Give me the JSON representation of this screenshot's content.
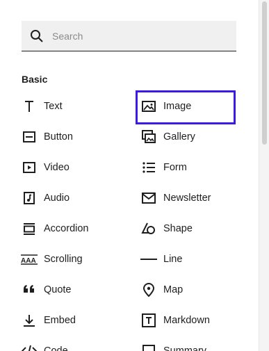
{
  "search": {
    "placeholder": "Search",
    "value": ""
  },
  "category": "Basic",
  "items": {
    "text": "Text",
    "image": "Image",
    "button": "Button",
    "gallery": "Gallery",
    "video": "Video",
    "form": "Form",
    "audio": "Audio",
    "newsletter": "Newsletter",
    "accordion": "Accordion",
    "shape": "Shape",
    "scrolling": "Scrolling",
    "line": "Line",
    "quote": "Quote",
    "map": "Map",
    "embed": "Embed",
    "markdown": "Markdown",
    "code": "Code",
    "summary": "Summary"
  },
  "selected_item": "image",
  "colors": {
    "selection": "#3c19e6",
    "text": "#1e1e1e",
    "search_bg": "#f0f0f0"
  }
}
